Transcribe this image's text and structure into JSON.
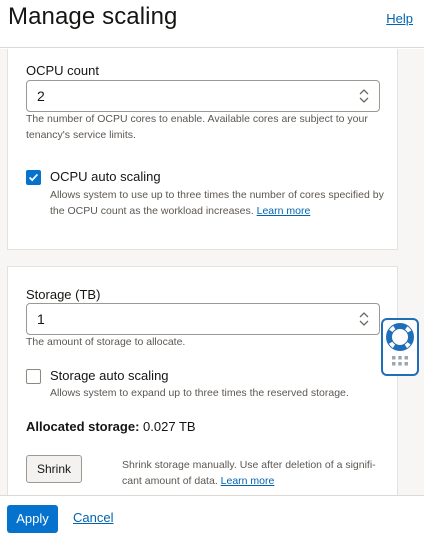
{
  "header": {
    "title": "Manage scaling",
    "help_label": "Help"
  },
  "ocpu": {
    "label": "OCPU count",
    "value": "2",
    "help": "The number of OCPU cores to enable. Available cores are subject to your tenancy's service limits.",
    "auto_scaling_label": "OCPU auto scaling",
    "auto_scaling_checked": true,
    "auto_scaling_desc": "Allows system to use up to three times the number of cores specified by the OCPU count as the workload increases.",
    "learn_more": "Learn more"
  },
  "storage": {
    "label": "Storage (TB)",
    "value": "1",
    "help": "The amount of storage to allocate.",
    "auto_scaling_label": "Storage auto scaling",
    "auto_scaling_checked": false,
    "auto_scaling_desc": "Allows system to expand up to three times the reserved storage.",
    "allocated_label": "Allocated storage:",
    "allocated_value": "0.027 TB",
    "shrink_label": "Shrink",
    "shrink_desc": "Shrink storage manually. Use after deletion of a signifi-cant amount of data.",
    "shrink_learn_more": "Learn more"
  },
  "footer": {
    "apply_label": "Apply",
    "cancel_label": "Cancel"
  },
  "icons": {
    "support": "lifebuoy-icon",
    "grid": "apps-grid-icon"
  },
  "colors": {
    "accent": "#0572ce",
    "link": "#0064b0",
    "page_bg": "#f7f6f5"
  }
}
